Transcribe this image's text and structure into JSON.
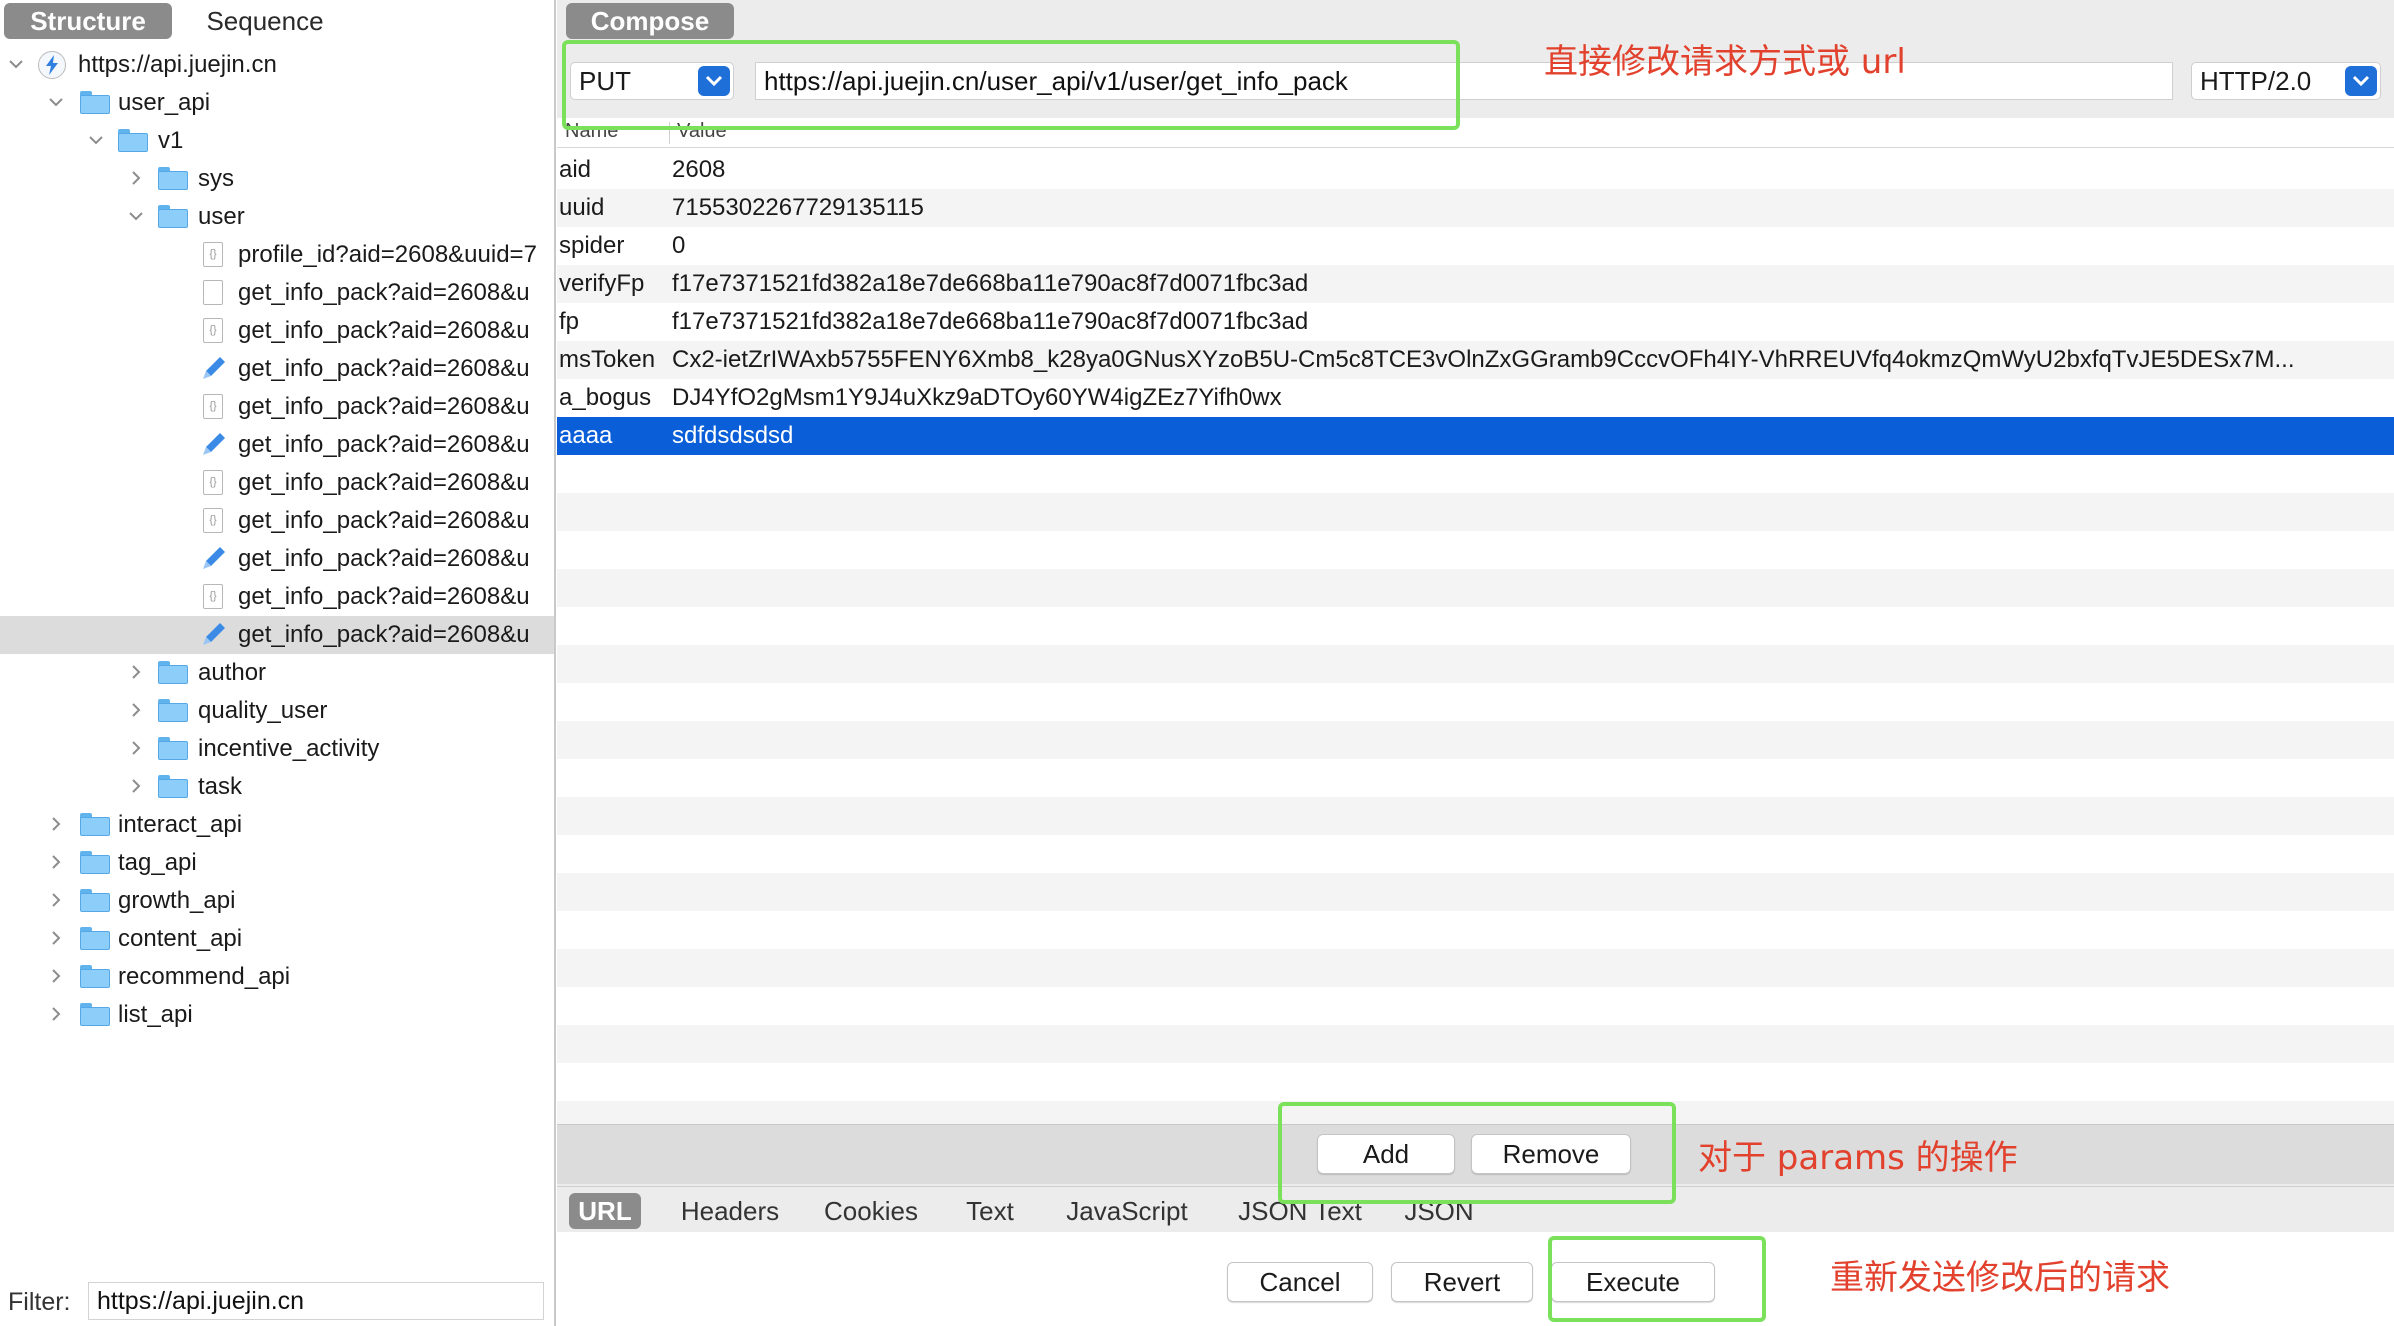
{
  "left_tabs": {
    "structure": "Structure",
    "sequence": "Sequence"
  },
  "tree": {
    "host": "https://api.juejin.cn",
    "user_api": "user_api",
    "v1": "v1",
    "sys": "sys",
    "user": "user",
    "files": [
      {
        "label": "profile_id?aid=2608&uuid=7",
        "icon": "json-file-icon"
      },
      {
        "label": "get_info_pack?aid=2608&u",
        "icon": "file-icon"
      },
      {
        "label": "get_info_pack?aid=2608&u",
        "icon": "json-file-icon"
      },
      {
        "label": "get_info_pack?aid=2608&u",
        "icon": "edited-pen-icon"
      },
      {
        "label": "get_info_pack?aid=2608&u",
        "icon": "json-file-icon"
      },
      {
        "label": "get_info_pack?aid=2608&u",
        "icon": "edited-pen-icon"
      },
      {
        "label": "get_info_pack?aid=2608&u",
        "icon": "json-file-icon"
      },
      {
        "label": "get_info_pack?aid=2608&u",
        "icon": "json-file-icon"
      },
      {
        "label": "get_info_pack?aid=2608&u",
        "icon": "edited-pen-icon"
      },
      {
        "label": "get_info_pack?aid=2608&u",
        "icon": "json-file-icon"
      },
      {
        "label": "get_info_pack?aid=2608&u",
        "icon": "edited-pen-icon"
      }
    ],
    "v1_folders": [
      "author",
      "quality_user",
      "incentive_activity",
      "task"
    ],
    "top_folders": [
      "interact_api",
      "tag_api",
      "growth_api",
      "content_api",
      "recommend_api",
      "list_api"
    ]
  },
  "filter": {
    "label": "Filter:",
    "value": "https://api.juejin.cn"
  },
  "compose": {
    "tab_label": "Compose",
    "method": "PUT",
    "url": "https://api.juejin.cn/user_api/v1/user/get_info_pack",
    "protocol": "HTTP/2.0"
  },
  "params": {
    "header_name": "Name",
    "header_value": "Value",
    "rows": [
      {
        "name": "aid",
        "value": "2608"
      },
      {
        "name": "uuid",
        "value": "7155302267729135115"
      },
      {
        "name": "spider",
        "value": "0"
      },
      {
        "name": "verifyFp",
        "value": "f17e7371521fd382a18e7de668ba11e790ac8f7d0071fbc3ad"
      },
      {
        "name": "fp",
        "value": "f17e7371521fd382a18e7de668ba11e790ac8f7d0071fbc3ad"
      },
      {
        "name": "msToken",
        "value": "Cx2-ietZrIWAxb5755FENY6Xmb8_k28ya0GNusXYzoB5U-Cm5c8TCE3vOlnZxGGramb9CccvOFh4IY-VhRREUVfq4okmzQmWyU2bxfqTvJE5DESx7M..."
      },
      {
        "name": "a_bogus",
        "value": "DJ4YfO2gMsm1Y9J4uXkz9aDTOy60YW4igZEz7Yifh0wx"
      },
      {
        "name": "aaaa",
        "value": "sdfdsdsdsd"
      }
    ],
    "selected_index": 7
  },
  "param_buttons": {
    "add": "Add",
    "remove": "Remove"
  },
  "view_tabs": [
    "URL",
    "Headers",
    "Cookies",
    "Text",
    "JavaScript",
    "JSON Text",
    "JSON"
  ],
  "actions": {
    "cancel": "Cancel",
    "revert": "Revert",
    "execute": "Execute"
  },
  "annotations": {
    "url_note": "直接修改请求方式或 url",
    "params_note": "对于 params 的操作",
    "execute_note": "重新发送修改后的请求"
  },
  "colors": {
    "highlight": "#7be05a",
    "note_text": "#e2412d",
    "selection": "#0a5fd8",
    "select_arrow": "#1f6fd8"
  }
}
